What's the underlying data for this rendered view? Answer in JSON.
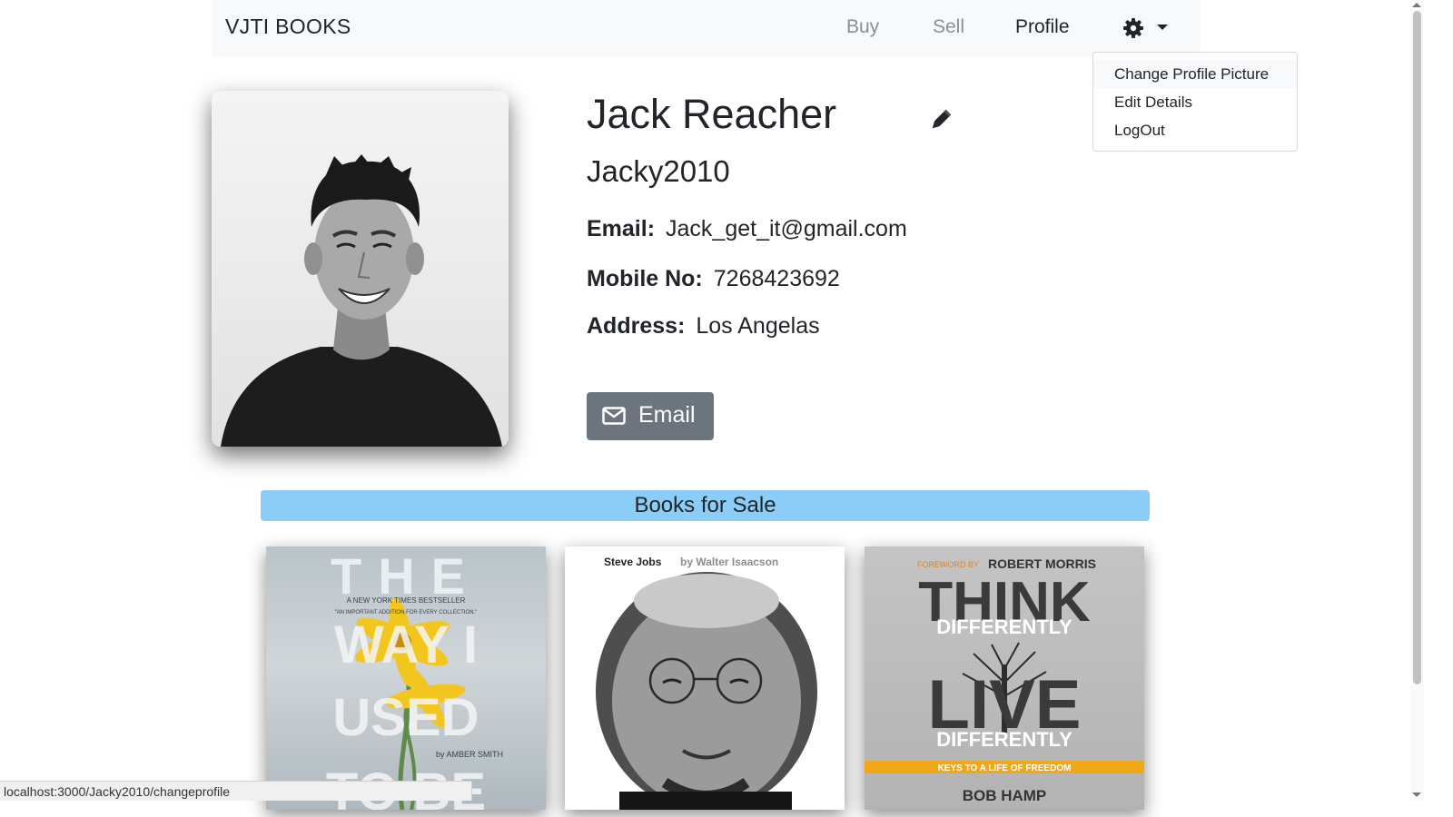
{
  "nav": {
    "brand": "VJTI BOOKS",
    "links": [
      "Buy",
      "Sell",
      "Profile"
    ],
    "settings_icon": "gear-icon"
  },
  "dropdown": {
    "items": [
      "Change Profile Picture",
      "Edit Details",
      "LogOut"
    ]
  },
  "profile": {
    "name": "Jack Reacher",
    "username": "Jacky2010",
    "email_label": "Email:",
    "email": "Jack_get_it@gmail.com",
    "mobile_label": "Mobile No:",
    "mobile": "7268423692",
    "address_label": "Address:",
    "address": "Los Angelas",
    "email_button": "Email",
    "edit_icon": "pencil-icon"
  },
  "books_section": {
    "title": "Books for Sale",
    "books": [
      {
        "cover_text": [
          "THE",
          "WAY I",
          "USED",
          "TO BE",
          "A NEW YORK TIMES BESTSELLER",
          "\"AN IMPORTANT ADDITION FOR EVERY COLLECTION.\"",
          "by AMBER SMITH"
        ]
      },
      {
        "cover_text": [
          "Steve Jobs",
          "by Walter Isaacson"
        ]
      },
      {
        "cover_text": [
          "FOREWORD BY",
          "ROBERT MORRIS",
          "THINK",
          "DIFFERENTLY",
          "LIVE",
          "DIFFERENTLY",
          "KEYS TO A LIFE OF FREEDOM",
          "BOB HAMP"
        ]
      }
    ]
  },
  "status_bar": {
    "url": "localhost:3000/Jacky2010/changeprofile"
  },
  "colors": {
    "navbar_bg": "#f8f9fa",
    "section_bar": "#8ccdf7",
    "email_button": "#6c757d"
  }
}
